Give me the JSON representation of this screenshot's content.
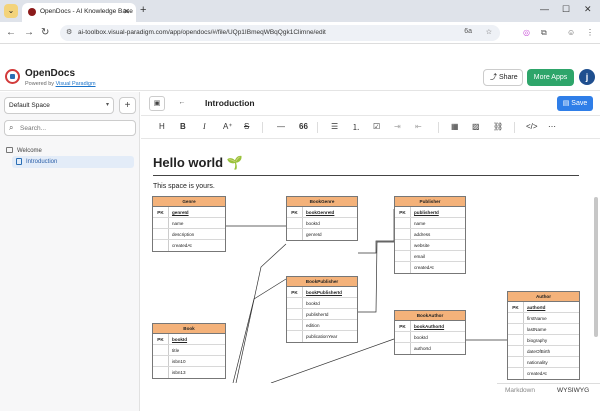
{
  "browser": {
    "tab_title": "OpenDocs - AI Knowledge Base",
    "url": "ai-toolbox.visual-paradigm.com/app/opendocs/#/file/UQp1IBmeqWBqQgk1Climne/edit"
  },
  "app": {
    "brand": "OpenDocs",
    "powered_prefix": "Powered by",
    "powered_link": "Visual Paradigm",
    "share_label": "Share",
    "more_apps_label": "More Apps",
    "avatar_letter": "j"
  },
  "sidebar": {
    "space": "Default Space",
    "search_placeholder": "Search...",
    "tree": [
      {
        "label": "Welcome"
      },
      {
        "label": "Introduction"
      }
    ]
  },
  "editor": {
    "doc_title": "Introduction",
    "save_label": "Save",
    "heading": "Hello world 🌱",
    "paragraph": "This space is yours.",
    "modes": [
      "Markdown",
      "WYSIWYG"
    ]
  },
  "erd": {
    "tables": [
      {
        "name": "Genre",
        "rows": [
          {
            "k": "PK",
            "c": "genreId",
            "pk": true
          },
          {
            "k": "",
            "c": "name"
          },
          {
            "k": "",
            "c": "description"
          },
          {
            "k": "",
            "c": "createdAt"
          }
        ]
      },
      {
        "name": "BookGenre",
        "rows": [
          {
            "k": "PK",
            "c": "bookGenreId",
            "pk": true
          },
          {
            "k": "",
            "c": "bookId"
          },
          {
            "k": "",
            "c": "genreId"
          }
        ]
      },
      {
        "name": "Publisher",
        "rows": [
          {
            "k": "PK",
            "c": "publisherId",
            "pk": true
          },
          {
            "k": "",
            "c": "name"
          },
          {
            "k": "",
            "c": "address"
          },
          {
            "k": "",
            "c": "website"
          },
          {
            "k": "",
            "c": "email"
          },
          {
            "k": "",
            "c": "createdAt"
          }
        ]
      },
      {
        "name": "BookPublisher",
        "rows": [
          {
            "k": "PK",
            "c": "bookPublisherId",
            "pk": true
          },
          {
            "k": "",
            "c": "bookId"
          },
          {
            "k": "",
            "c": "publisherId"
          },
          {
            "k": "",
            "c": "edition"
          },
          {
            "k": "",
            "c": "publicationYear"
          }
        ]
      },
      {
        "name": "BookAuthor",
        "rows": [
          {
            "k": "PK",
            "c": "bookAuthorId",
            "pk": true
          },
          {
            "k": "",
            "c": "bookId"
          },
          {
            "k": "",
            "c": "authorId"
          }
        ]
      },
      {
        "name": "Book",
        "rows": [
          {
            "k": "PK",
            "c": "bookId",
            "pk": true
          },
          {
            "k": "",
            "c": "title"
          },
          {
            "k": "",
            "c": "isbn10"
          },
          {
            "k": "",
            "c": "isbn13"
          }
        ]
      },
      {
        "name": "Author",
        "rows": [
          {
            "k": "PK",
            "c": "authorId",
            "pk": true
          },
          {
            "k": "",
            "c": "firstName"
          },
          {
            "k": "",
            "c": "lastName"
          },
          {
            "k": "",
            "c": "biography"
          },
          {
            "k": "",
            "c": "dateOfBirth"
          },
          {
            "k": "",
            "c": "nationality"
          },
          {
            "k": "",
            "c": "createdAt"
          }
        ]
      }
    ]
  },
  "colors": {
    "accent": "#2f7ee8",
    "apps": "#2ea56a",
    "table_header": "#f4b27a"
  }
}
